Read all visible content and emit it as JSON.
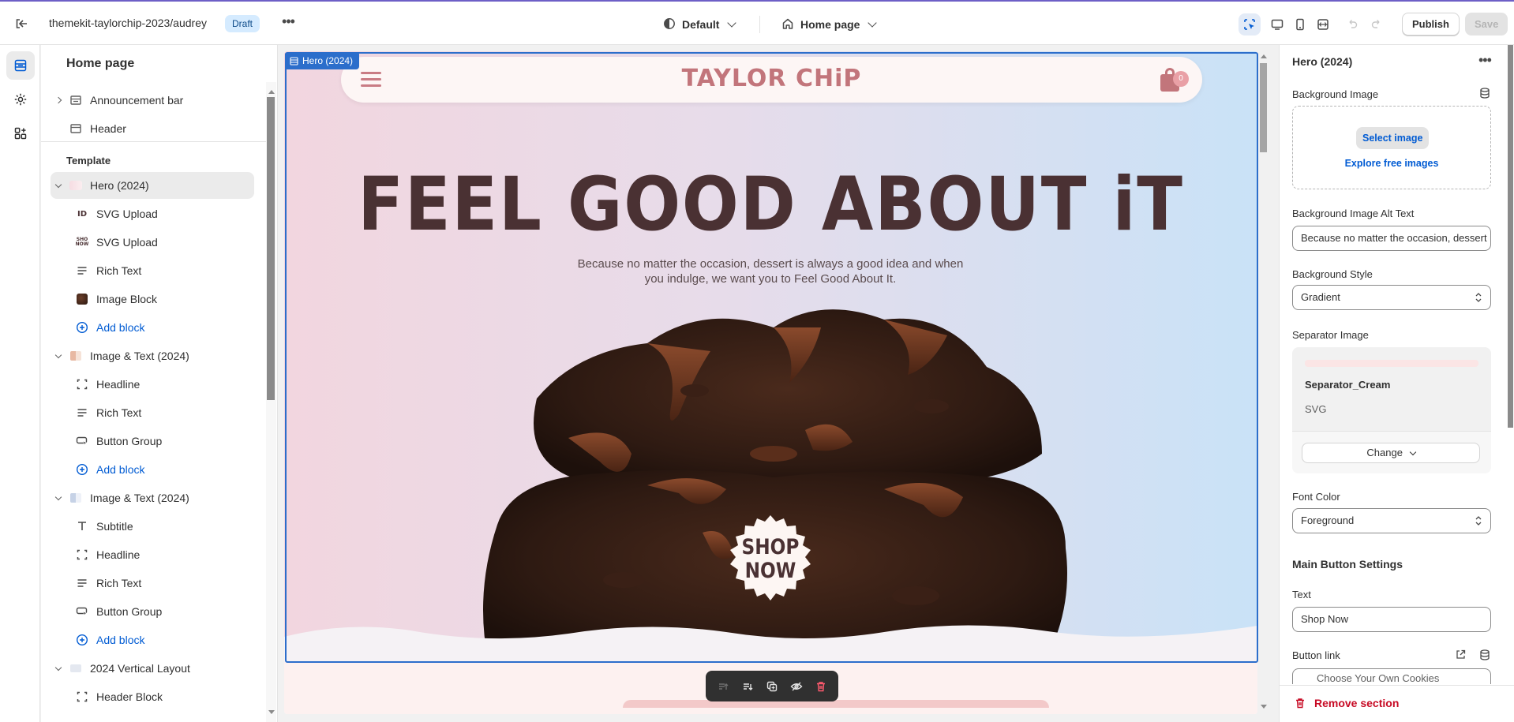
{
  "topbar": {
    "store_path": "themekit-taylorchip-2023/audrey",
    "status_badge": "Draft",
    "theme_selector": "Default",
    "page_selector": "Home page",
    "publish_label": "Publish",
    "save_label": "Save"
  },
  "sidebar": {
    "title": "Home page",
    "template_label": "Template",
    "items": [
      {
        "label": "Announcement bar"
      },
      {
        "label": "Header"
      },
      {
        "label": "Hero (2024)"
      },
      {
        "label": "SVG Upload"
      },
      {
        "label": "SVG Upload"
      },
      {
        "label": "Rich Text"
      },
      {
        "label": "Image Block"
      },
      {
        "label": "Add block"
      },
      {
        "label": "Image & Text (2024)"
      },
      {
        "label": "Headline"
      },
      {
        "label": "Rich Text"
      },
      {
        "label": "Button Group"
      },
      {
        "label": "Add block"
      },
      {
        "label": "Image & Text (2024)"
      },
      {
        "label": "Subtitle"
      },
      {
        "label": "Headline"
      },
      {
        "label": "Rich Text"
      },
      {
        "label": "Button Group"
      },
      {
        "label": "Add block"
      },
      {
        "label": "2024 Vertical Layout"
      },
      {
        "label": "Header Block"
      }
    ]
  },
  "preview": {
    "section_tag": "Hero (2024)",
    "brand": "TAYLOR CHiP",
    "cart_count": "0",
    "heading": "FEEL GOOD ABOUT iT",
    "subtext": "Because no matter the occasion, dessert is always a good idea and when you indulge, we want you to Feel Good About It.",
    "badge_line1": "SHOP",
    "badge_line2": "NOW"
  },
  "settings": {
    "section_title": "Hero (2024)",
    "bg_image_label": "Background Image",
    "select_image": "Select image",
    "explore_images": "Explore free images",
    "alt_text_label": "Background Image Alt Text",
    "alt_text_value": "Because no matter the occasion, dessert is always a good idea",
    "bg_style_label": "Background Style",
    "bg_style_value": "Gradient",
    "separator_label": "Separator Image",
    "separator_name": "Separator_Cream",
    "separator_type": "SVG",
    "change_label": "Change",
    "font_color_label": "Font Color",
    "font_color_value": "Foreground",
    "main_button_heading": "Main Button Settings",
    "text_label": "Text",
    "text_value": "Shop Now",
    "button_link_label": "Button link",
    "button_link_value": "Choose Your Own Cookies",
    "remove_section": "Remove section"
  },
  "colors": {
    "accent": "#2c6ecb",
    "brand": "#c2757b",
    "heading": "#4a3133",
    "danger": "#c70a24"
  }
}
